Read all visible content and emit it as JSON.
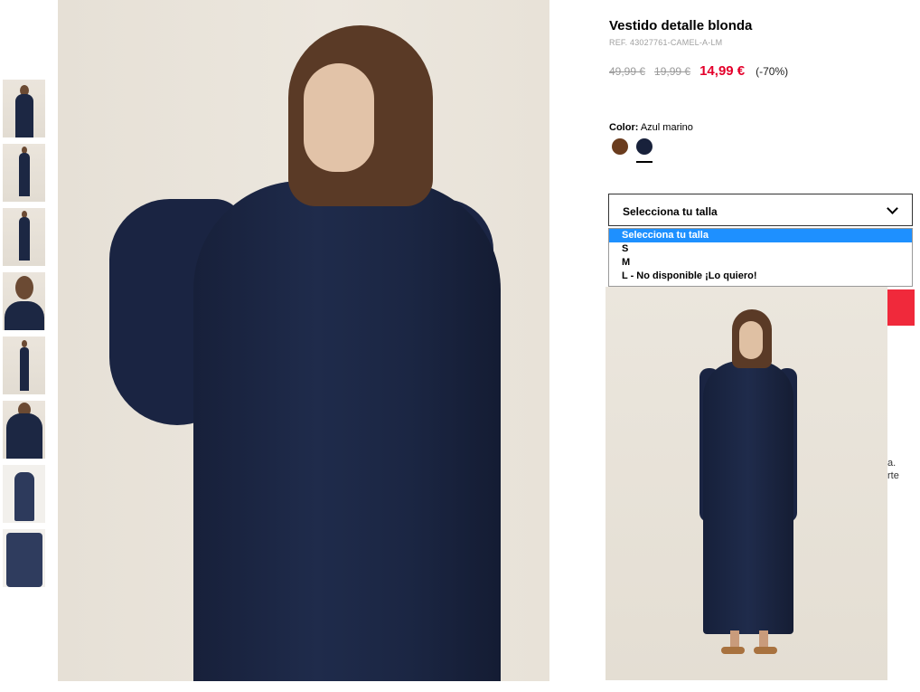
{
  "product": {
    "title": "Vestido detalle blonda",
    "ref": "REF. 43027761-CAMEL-A-LM",
    "price_original": "49,99 €",
    "price_previous": "19,99 €",
    "price_current": "14,99 €",
    "discount": "(-70%)",
    "price_color": "#e4002b"
  },
  "color": {
    "label": "Color:",
    "selected": "Azul marino",
    "swatches": [
      {
        "name": "camel",
        "hex": "#6a3c1e"
      },
      {
        "name": "azul-marino",
        "hex": "#18213b",
        "selected": true
      }
    ]
  },
  "size_select": {
    "value": "Selecciona tu talla",
    "options": [
      "Selecciona tu talla",
      "S",
      "M",
      "L - No disponible ¡Lo quiero!"
    ],
    "highlighted_index": 0,
    "highlight_color": "#1e90ff"
  },
  "side_clipped_text": [
    "a.",
    "rte"
  ],
  "accent_color": "#f0293b"
}
